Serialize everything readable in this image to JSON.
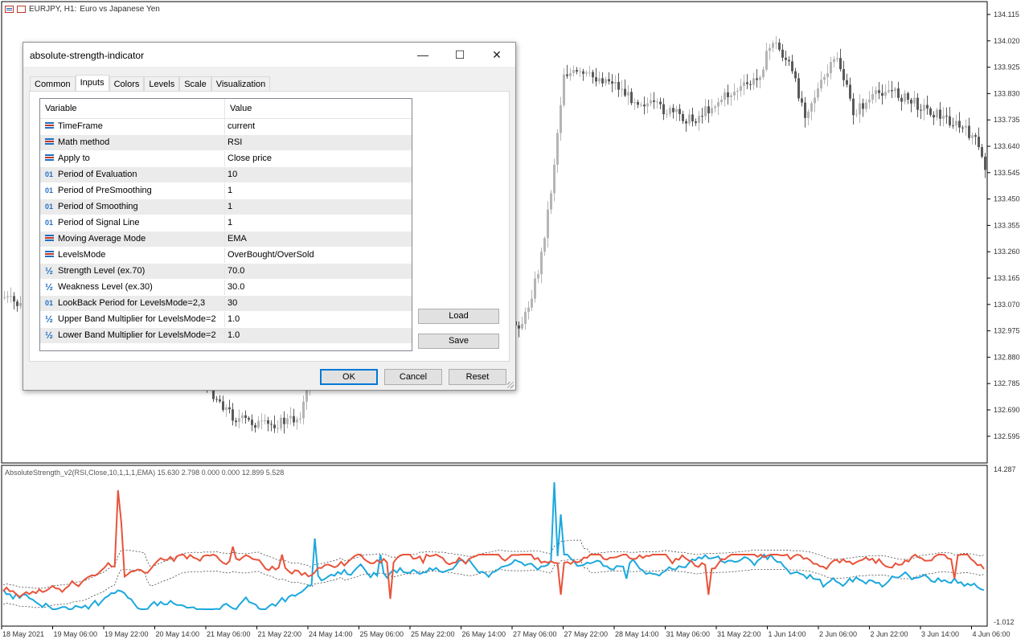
{
  "chart_header": {
    "symbol_text": "EURJPY, H1:",
    "description": "Euro vs Japanese Yen"
  },
  "price_axis_labels": [
    "134.115",
    "134.020",
    "133.925",
    "133.830",
    "133.735",
    "133.640",
    "133.545",
    "133.450",
    "133.355",
    "133.260",
    "133.165",
    "133.070",
    "132.975",
    "132.880",
    "132.785",
    "132.690",
    "132.595"
  ],
  "indicator_axis_labels": [
    "14.287",
    "-1.012"
  ],
  "time_axis_labels": [
    "18 May 2021",
    "19 May 06:00",
    "19 May 22:00",
    "20 May 14:00",
    "21 May 06:00",
    "21 May 22:00",
    "24 May 14:00",
    "25 May 06:00",
    "25 May 22:00",
    "26 May 14:00",
    "27 May 06:00",
    "27 May 22:00",
    "28 May 14:00",
    "31 May 06:00",
    "31 May 22:00",
    "1 Jun 14:00",
    "2 Jun 06:00",
    "2 Jun 22:00",
    "3 Jun 14:00",
    "4 Jun 06:00"
  ],
  "indicator_label": "AbsoluteStrength_v2(RSI,Close,10,1,1,1,EMA) 15.630 2.798 0.000 0.000 12.899 5.528",
  "colors": {
    "bull_line": "#1ca8dd",
    "bear_line": "#e8533a",
    "band_line": "#333333",
    "candle_bull": "#b5b5b5",
    "candle_bear": "#5a5a5a"
  },
  "dialog": {
    "title": "absolute-strength-indicator",
    "window_buttons": {
      "minimize": "—",
      "maximize": "☐",
      "close": "✕"
    },
    "tabs": [
      "Common",
      "Inputs",
      "Colors",
      "Levels",
      "Scale",
      "Visualization"
    ],
    "active_tab": "Inputs",
    "grid_headers": {
      "variable": "Variable",
      "value": "Value"
    },
    "params": [
      {
        "icon": "enum",
        "name": "TimeFrame",
        "value": "current"
      },
      {
        "icon": "enum",
        "name": "Math method",
        "value": "RSI"
      },
      {
        "icon": "enum",
        "name": "Apply to",
        "value": "Close price"
      },
      {
        "icon": "int",
        "name": "Period of Evaluation",
        "value": "10"
      },
      {
        "icon": "int",
        "name": "Period of PreSmoothing",
        "value": "1"
      },
      {
        "icon": "int",
        "name": "Period of Smoothing",
        "value": "1"
      },
      {
        "icon": "int",
        "name": "Period of Signal Line",
        "value": "1"
      },
      {
        "icon": "enum",
        "name": "Moving Average Mode",
        "value": "EMA"
      },
      {
        "icon": "enum",
        "name": "LevelsMode",
        "value": "OverBought/OverSold"
      },
      {
        "icon": "double",
        "name": "Strength Level (ex.70)",
        "value": "70.0"
      },
      {
        "icon": "double",
        "name": "Weakness Level (ex.30)",
        "value": "30.0"
      },
      {
        "icon": "int",
        "name": "LookBack Period for LevelsMode=2,3",
        "value": "30"
      },
      {
        "icon": "double",
        "name": "Upper Band Multiplier for LevelsMode=2",
        "value": "1.0"
      },
      {
        "icon": "double",
        "name": "Lower Band Multiplier for LevelsMode=2",
        "value": "1.0"
      }
    ],
    "load_label": "Load",
    "save_label": "Save",
    "ok_label": "OK",
    "cancel_label": "Cancel",
    "reset_label": "Reset"
  }
}
